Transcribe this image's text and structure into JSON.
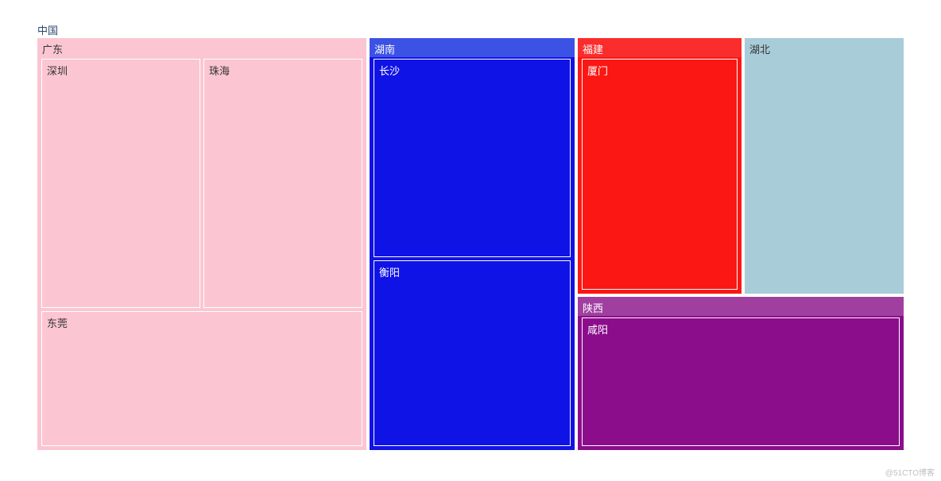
{
  "root_label": "中国",
  "watermark": "@51CTO博客",
  "chart_data": {
    "type": "treemap",
    "root": "中国",
    "nodes": [
      {
        "name": "广东",
        "value": 44,
        "children": [
          {
            "name": "深圳",
            "value": 17
          },
          {
            "name": "珠海",
            "value": 16
          },
          {
            "name": "东莞",
            "value": 11
          }
        ]
      },
      {
        "name": "湖南",
        "value": 27,
        "children": [
          {
            "name": "长沙",
            "value": 14
          },
          {
            "name": "衡阳",
            "value": 13
          }
        ]
      },
      {
        "name": "福建",
        "value": 14,
        "children": [
          {
            "name": "厦门",
            "value": 14
          }
        ]
      },
      {
        "name": "湖北",
        "value": 13,
        "children": []
      },
      {
        "name": "陕西",
        "value": 12,
        "children": [
          {
            "name": "咸阳",
            "value": 12
          }
        ]
      }
    ]
  },
  "labels": {
    "gd": "广东",
    "sz": "深圳",
    "zh": "珠海",
    "dg": "东莞",
    "hn": "湖南",
    "cs": "长沙",
    "hy": "衡阳",
    "fj": "福建",
    "xm": "厦门",
    "hb": "湖北",
    "sx": "陕西",
    "xy": "咸阳"
  }
}
